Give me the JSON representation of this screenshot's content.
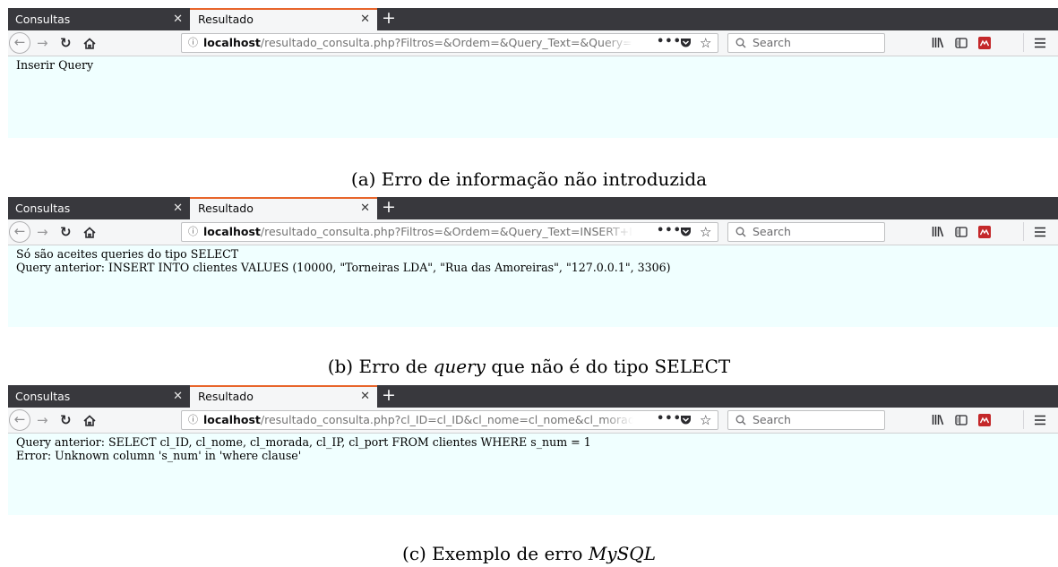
{
  "shared": {
    "tab_inactive": "Consultas",
    "tab_active": "Resultado",
    "url_host": "localhost",
    "search_placeholder": "Search",
    "icons": {
      "info": "info-icon",
      "back": "back-arrow-icon",
      "forward": "forward-arrow-icon",
      "reload": "reload-icon",
      "home": "home-icon",
      "dots": "page-actions-icon",
      "pocket": "pocket-icon",
      "star": "bookmark-star-icon",
      "search": "search-icon",
      "library": "library-icon",
      "sidebar": "sidebar-icon",
      "extension": "extension-icon",
      "menu": "hamburger-menu-icon"
    },
    "colors": {
      "tab_bar": "#38383d",
      "active_tab_accent": "#e8652b",
      "page_background": "#f0ffff"
    }
  },
  "screenshots": [
    {
      "url_path": "/resultado_consulta.php?Filtros=&Ordem=&Query_Text=&Query=",
      "lines": [
        "Inserir Query",
        ""
      ],
      "caption_pre": "(a) Erro de informação não introduzida",
      "caption_em": "",
      "caption_post": ""
    },
    {
      "url_path": "/resultado_consulta.php?Filtros=&Ordem=&Query_Text=INSERT+I",
      "lines": [
        "Só são aceites queries do tipo SELECT",
        "Query anterior: INSERT INTO clientes VALUES (10000, \"Torneiras LDA\", \"Rua das Amoreiras\", \"127.0.0.1\", 3306)"
      ],
      "caption_pre": "(b) Erro de ",
      "caption_em": "query",
      "caption_post": " que não é do tipo SELECT"
    },
    {
      "url_path": "/resultado_consulta.php?cl_ID=cl_ID&cl_nome=cl_nome&cl_morad",
      "lines": [
        "Query anterior: SELECT cl_ID, cl_nome, cl_morada, cl_IP, cl_port FROM clientes WHERE s_num = 1",
        "Error: Unknown column 's_num' in 'where clause'"
      ],
      "caption_pre": "(c) Exemplo de erro ",
      "caption_em": "MySQL",
      "caption_post": ""
    }
  ]
}
